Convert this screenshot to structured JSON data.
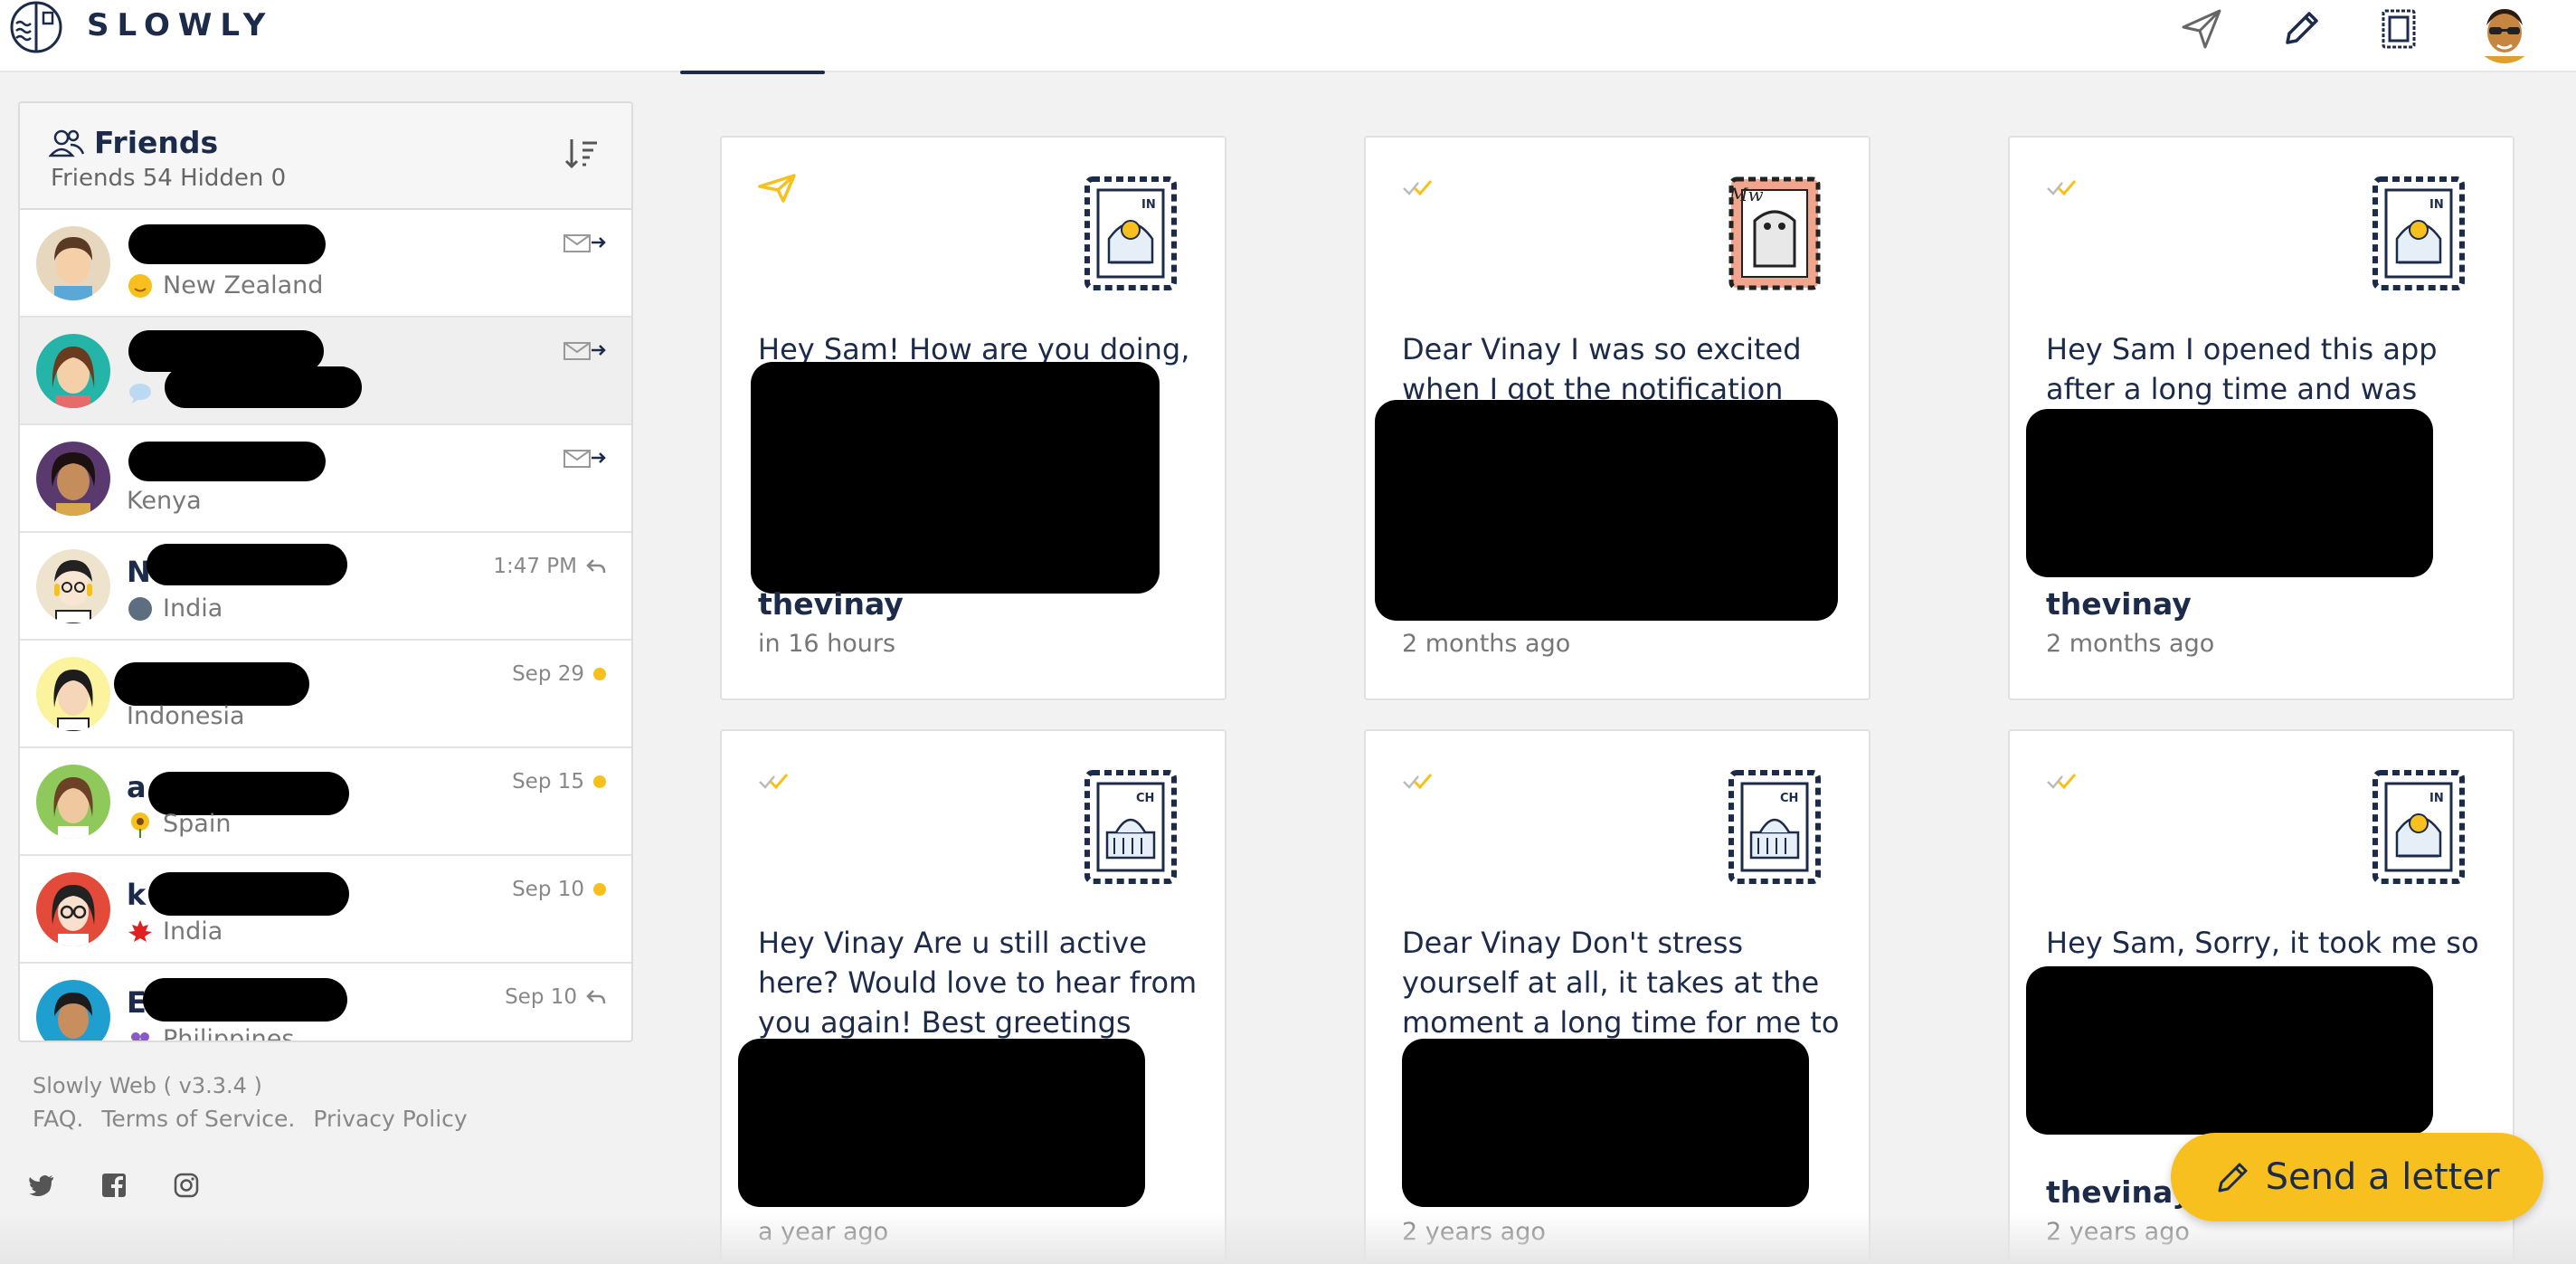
{
  "app": {
    "name": "SLOWLY",
    "nav_icons": [
      "send-icon",
      "pen-icon",
      "stamp-icon"
    ],
    "accent_color": "#f7c01e",
    "navy_color": "#1c2b4a"
  },
  "friends": {
    "title": "Friends",
    "stats": "Friends 54  Hidden 0",
    "items": [
      {
        "name": "",
        "location": "New Zealand",
        "meta": ""
      },
      {
        "name": "",
        "location": "",
        "meta": ""
      },
      {
        "name": "",
        "location": "Kenya",
        "meta": ""
      },
      {
        "name": "N ur",
        "location": "India",
        "meta": "1:47 PM"
      },
      {
        "name": "",
        "location": "Indonesia",
        "meta": "Sep 29"
      },
      {
        "name": "a",
        "location": "Spain",
        "meta": "Sep 15"
      },
      {
        "name": "k th",
        "location": "India",
        "meta": "Sep 10"
      },
      {
        "name": "E",
        "location": "Philippines",
        "meta": "Sep 10"
      }
    ]
  },
  "footer": {
    "version": "Slowly Web ( v3.3.4 )",
    "links": [
      "FAQ.",
      "Terms of Service.",
      "Privacy Policy"
    ]
  },
  "letters": [
    {
      "text": "Hey Sam! How are you doing, es",
      "user": "thevinay",
      "time": "in 16 hours",
      "stamp": "IN",
      "status": "outgoing"
    },
    {
      "text": "Dear Vinay I was so excited when I got the notification that",
      "user": "",
      "time": "2 months ago",
      "stamp": "photo",
      "status": "read"
    },
    {
      "text": "Hey Sam I opened this app after a long time and was",
      "user": "thevinay",
      "time": "2 months ago",
      "stamp": "IN",
      "status": "read"
    },
    {
      "text": "Hey Vinay Are u still active here? Would love to hear from you again! Best greetings Sam",
      "user": "",
      "time": "a year ago",
      "stamp": "CH",
      "status": "read"
    },
    {
      "text": "Dear Vinay Don't stress yourself at all, it takes at the moment a long time for me to",
      "user": "",
      "time": "2 years ago",
      "stamp": "CH",
      "status": "read"
    },
    {
      "text": "Hey Sam, Sorry, it took me so y",
      "user": "thevinay",
      "time": "2 years ago",
      "stamp": "IN",
      "status": "read"
    }
  ],
  "fab": {
    "label": "Send a letter"
  }
}
